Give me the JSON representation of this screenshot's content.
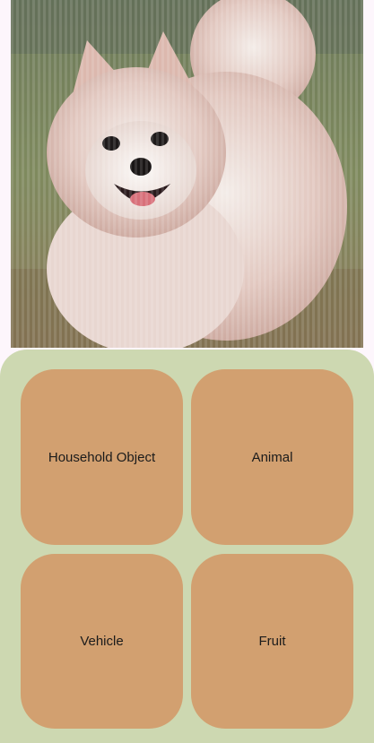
{
  "image": {
    "subject_icon": "pomeranian-dog-photo"
  },
  "choices": [
    {
      "label": "Household Object"
    },
    {
      "label": "Animal"
    },
    {
      "label": "Vehicle"
    },
    {
      "label": "Fruit"
    }
  ],
  "colors": {
    "panel": "#cdd8b1",
    "choice_button": "#d2a070",
    "background": "#fdf6fc"
  }
}
